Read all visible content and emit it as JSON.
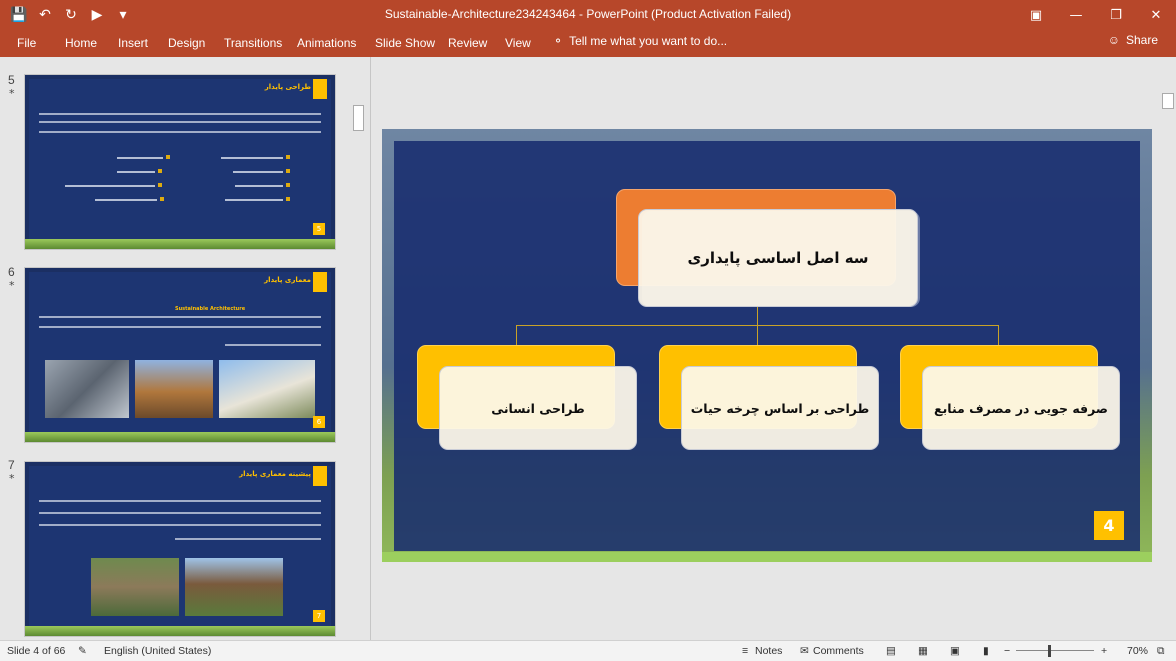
{
  "window": {
    "title": "Sustainable-Architecture234243464 - PowerPoint (Product Activation Failed)"
  },
  "ribbon": {
    "file": "File",
    "tabs": [
      "Home",
      "Insert",
      "Design",
      "Transitions",
      "Animations",
      "Slide Show",
      "Review",
      "View"
    ],
    "tell_me": "Tell me what you want to do...",
    "share": "Share"
  },
  "thumbnails": [
    {
      "number": "5",
      "marker": "*",
      "title": "طراحی پایدار",
      "page": "5"
    },
    {
      "number": "6",
      "marker": "*",
      "title": "معماری پایدار",
      "highlight": "Sustainable Architecture",
      "page": "6"
    },
    {
      "number": "7",
      "marker": "*",
      "title": "پیشینه معماری پایدار",
      "page": "7"
    }
  ],
  "slide": {
    "main_title": "سه اصل اساسی پایداری",
    "principles": [
      "صرفه جویی در مصرف منابع",
      "طراحی بر اساس چرخه حیات",
      "طراحی انسانی"
    ],
    "page_number": "4"
  },
  "status": {
    "slide_info": "Slide 4 of 66",
    "language": "English (United States)",
    "notes": "Notes",
    "comments": "Comments",
    "zoom": "70%"
  },
  "colors": {
    "ribbon": "#b7472a",
    "slide_panel": "#1d3572",
    "accent_orange": "#ed7d31",
    "accent_yellow": "#ffc000"
  }
}
